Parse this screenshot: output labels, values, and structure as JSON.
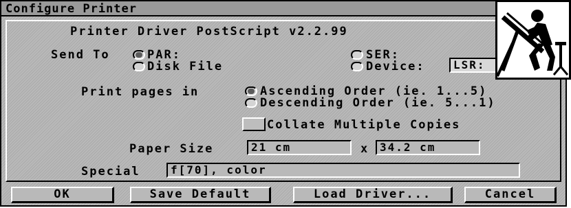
{
  "window": {
    "title": "Configure Printer"
  },
  "header": {
    "driver": "Printer Driver PostScript v2.2.99"
  },
  "send_to": {
    "label": "Send To",
    "options": [
      "PAR:",
      "Disk File",
      "SER:",
      "Device:"
    ],
    "selected": "PAR:",
    "device_value": "LSR:"
  },
  "print_pages": {
    "label": "Print pages in",
    "options": [
      "Ascending Order (ie. 1...5)",
      "Descending Order (ie. 5...1)"
    ],
    "selected": "Ascending Order (ie. 1...5)"
  },
  "collate": {
    "label": "Collate Multiple Copies",
    "checked": false
  },
  "paper": {
    "label": "Paper Size",
    "width": "21 cm",
    "separator": "x",
    "height": "34.2 cm"
  },
  "special": {
    "label": "Special",
    "value": "f[70], color"
  },
  "buttons": {
    "ok": "OK",
    "save": "Save Default",
    "load": "Load Driver...",
    "cancel": "Cancel"
  },
  "icons": {
    "logo": "drafting-person-icon"
  }
}
